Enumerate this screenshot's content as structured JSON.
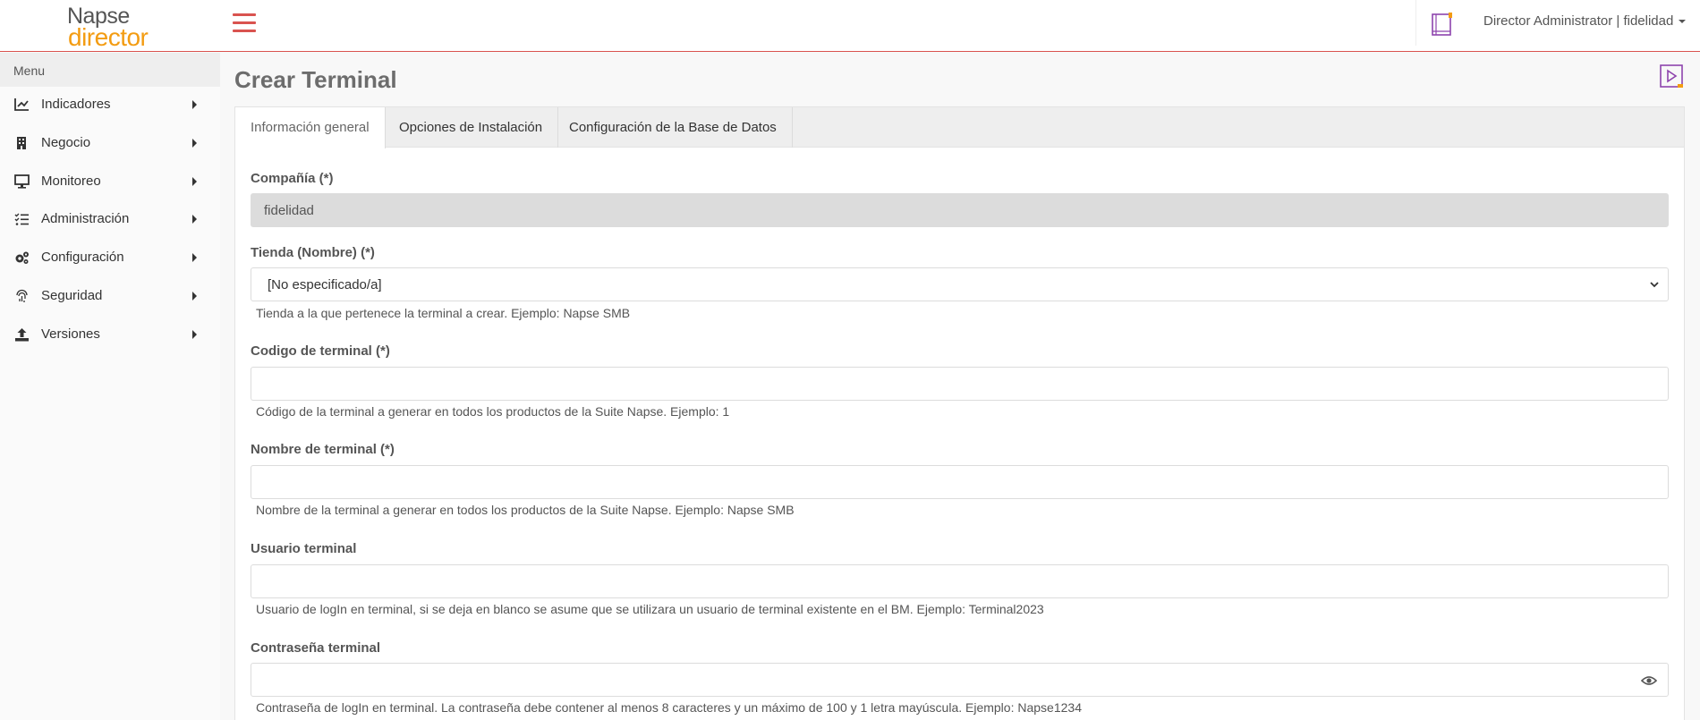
{
  "brand": {
    "line1": "Napse",
    "line2": "director"
  },
  "header": {
    "user_label": "Director Administrator | fidelidad"
  },
  "sidebar": {
    "title": "Menu",
    "items": [
      {
        "label": "Indicadores",
        "icon": "chart-line-icon"
      },
      {
        "label": "Negocio",
        "icon": "building-icon"
      },
      {
        "label": "Monitoreo",
        "icon": "desktop-icon"
      },
      {
        "label": "Administración",
        "icon": "tasks-icon"
      },
      {
        "label": "Configuración",
        "icon": "cogs-icon"
      },
      {
        "label": "Seguridad",
        "icon": "fingerprint-icon"
      },
      {
        "label": "Versiones",
        "icon": "upload-icon"
      }
    ]
  },
  "page": {
    "title": "Crear Terminal"
  },
  "tabs": [
    {
      "label": "Información general",
      "active": true
    },
    {
      "label": "Opciones de Instalación",
      "active": false
    },
    {
      "label": "Configuración de la Base de Datos",
      "active": false
    }
  ],
  "form": {
    "company": {
      "label": "Compañía (*)",
      "value": "fidelidad"
    },
    "store": {
      "label": "Tienda (Nombre) (*)",
      "value": "[No especificado/a]",
      "help": "Tienda a la que pertenece la terminal a crear. Ejemplo: Napse SMB"
    },
    "terminal_code": {
      "label": "Codigo de terminal (*)",
      "value": "",
      "help": "Código de la terminal a generar en todos los productos de la Suite Napse. Ejemplo: 1"
    },
    "terminal_name": {
      "label": "Nombre de terminal (*)",
      "value": "",
      "help": "Nombre de la terminal a generar en todos los productos de la Suite Napse. Ejemplo: Napse SMB"
    },
    "terminal_user": {
      "label": "Usuario terminal",
      "value": "",
      "help": "Usuario de logIn en terminal, si se deja en blanco se asume que se utilizara un usuario de terminal existente en el BM. Ejemplo: Terminal2023"
    },
    "terminal_password": {
      "label": "Contraseña terminal",
      "value": "",
      "help": "Contraseña de logIn en terminal. La contraseña debe contener al menos 8 caracteres y un máximo de 100 y 1 letra mayúscula. Ejemplo: Napse1234"
    }
  },
  "colors": {
    "accent": "#d9534f",
    "brand_orange": "#f39c12",
    "icon_purple": "#8e44ad"
  }
}
